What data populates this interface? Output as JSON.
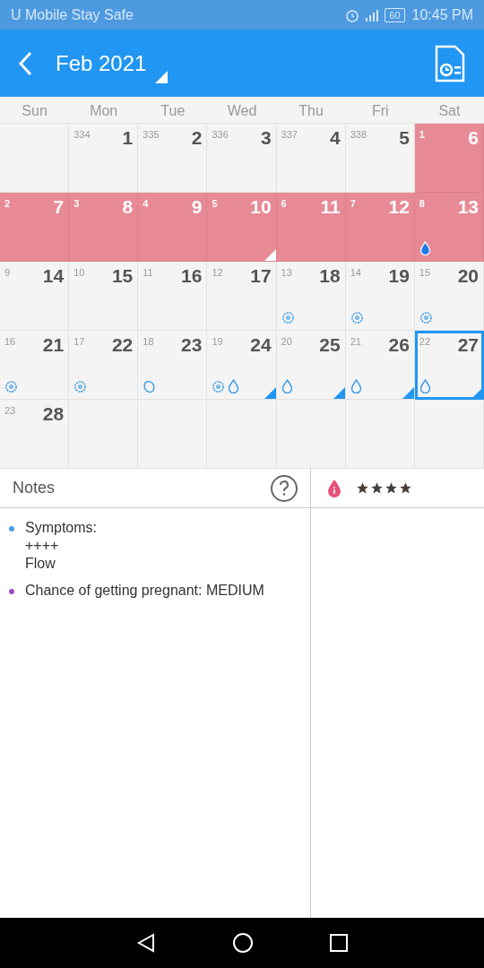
{
  "status_bar": {
    "carrier": "U Mobile Stay Safe",
    "battery": "60",
    "time": "10:45 PM"
  },
  "header": {
    "month": "Feb 2021"
  },
  "weekdays": [
    "Sun",
    "Mon",
    "Tue",
    "Wed",
    "Thu",
    "Fri",
    "Sat"
  ],
  "cells": [
    {
      "kind": "empty"
    },
    {
      "kind": "normal",
      "cycle_day": "334",
      "day": "1"
    },
    {
      "kind": "normal",
      "cycle_day": "335",
      "day": "2"
    },
    {
      "kind": "normal",
      "cycle_day": "336",
      "day": "3"
    },
    {
      "kind": "normal",
      "cycle_day": "337",
      "day": "4"
    },
    {
      "kind": "normal",
      "cycle_day": "338",
      "day": "5"
    },
    {
      "kind": "period",
      "cycle_day": "1",
      "day": "6"
    },
    {
      "kind": "period",
      "cycle_day": "2",
      "day": "7"
    },
    {
      "kind": "period",
      "cycle_day": "3",
      "day": "8"
    },
    {
      "kind": "period",
      "cycle_day": "4",
      "day": "9"
    },
    {
      "kind": "period",
      "cycle_day": "5",
      "day": "10",
      "note": true
    },
    {
      "kind": "period",
      "cycle_day": "6",
      "day": "11"
    },
    {
      "kind": "period",
      "cycle_day": "7",
      "day": "12"
    },
    {
      "kind": "period",
      "cycle_day": "8",
      "day": "13",
      "icons": [
        {
          "kind": "flow"
        }
      ]
    },
    {
      "kind": "normal",
      "cycle_day": "9",
      "day": "14"
    },
    {
      "kind": "normal",
      "cycle_day": "10",
      "day": "15"
    },
    {
      "kind": "normal",
      "cycle_day": "11",
      "day": "16"
    },
    {
      "kind": "normal",
      "cycle_day": "12",
      "day": "17"
    },
    {
      "kind": "normal",
      "cycle_day": "13",
      "day": "18",
      "icons": [
        {
          "kind": "gear"
        }
      ]
    },
    {
      "kind": "normal",
      "cycle_day": "14",
      "day": "19",
      "icons": [
        {
          "kind": "gear"
        }
      ]
    },
    {
      "kind": "normal",
      "cycle_day": "15",
      "day": "20",
      "icons": [
        {
          "kind": "gear"
        }
      ]
    },
    {
      "kind": "normal",
      "cycle_day": "16",
      "day": "21",
      "icons": [
        {
          "kind": "gear"
        }
      ]
    },
    {
      "kind": "normal",
      "cycle_day": "17",
      "day": "22",
      "icons": [
        {
          "kind": "gear"
        }
      ]
    },
    {
      "kind": "normal",
      "cycle_day": "18",
      "day": "23",
      "icons": [
        {
          "kind": "egg"
        }
      ]
    },
    {
      "kind": "normal",
      "cycle_day": "19",
      "day": "24",
      "icons": [
        {
          "kind": "gear"
        },
        {
          "kind": "drop"
        }
      ],
      "note": true
    },
    {
      "kind": "normal",
      "cycle_day": "20",
      "day": "25",
      "icons": [
        {
          "kind": "drop"
        }
      ],
      "note": true
    },
    {
      "kind": "normal",
      "cycle_day": "21",
      "day": "26",
      "icons": [
        {
          "kind": "drop"
        }
      ],
      "note": true
    },
    {
      "kind": "normal",
      "cycle_day": "22",
      "day": "27",
      "icons": [
        {
          "kind": "drop"
        }
      ],
      "note": true,
      "selected": true
    },
    {
      "kind": "normal",
      "cycle_day": "23",
      "day": "28"
    },
    {
      "kind": "empty"
    },
    {
      "kind": "empty"
    },
    {
      "kind": "empty"
    },
    {
      "kind": "empty"
    },
    {
      "kind": "empty"
    },
    {
      "kind": "empty"
    }
  ],
  "notes": {
    "title": "Notes",
    "items": [
      {
        "text": "Symptoms:\n++++\nFlow",
        "color": "#4a9fe8"
      },
      {
        "text": "Chance of getting pregnant: MEDIUM",
        "color": "#9b4fc0"
      }
    ]
  },
  "rating": {
    "stars": 4
  }
}
